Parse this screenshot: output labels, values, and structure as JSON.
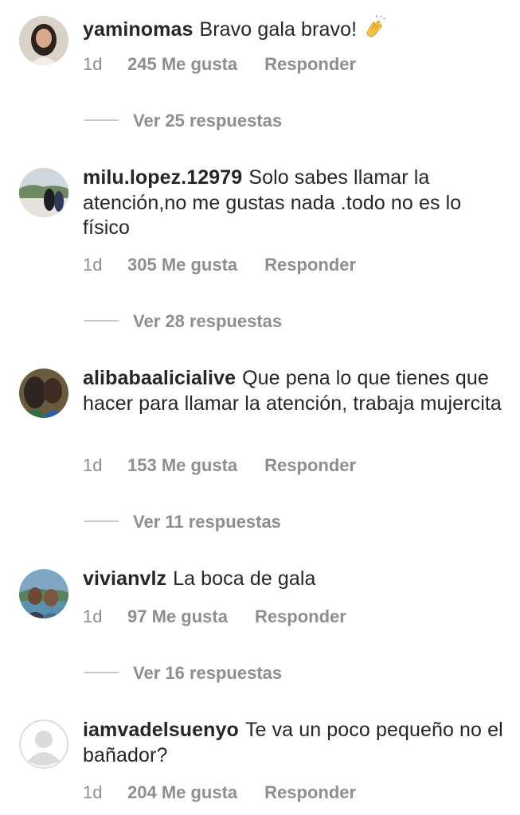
{
  "comments": [
    {
      "username": "yaminomas",
      "text": "Bravo gala bravo!",
      "emoji": "clapping-hands-icon",
      "time": "1d",
      "likes": "245 Me gusta",
      "reply_label": "Responder",
      "view_replies": "Ver 25 respuestas"
    },
    {
      "username": "milu.lopez.12979",
      "text": "Solo sabes llamar la atención,no me gustas nada .todo no es lo físico",
      "time": "1d",
      "likes": "305 Me gusta",
      "reply_label": "Responder",
      "view_replies": "Ver 28 respuestas"
    },
    {
      "username": "alibabaalicialive",
      "text": "Que pena lo que tienes que hacer para llamar la atención, trabaja mujercita",
      "time": "1d",
      "likes": "153 Me gusta",
      "reply_label": "Responder",
      "view_replies": "Ver 11 respuestas"
    },
    {
      "username": "vivianvlz",
      "text": "La boca de gala",
      "time": "1d",
      "likes": "97 Me gusta",
      "reply_label": "Responder",
      "view_replies": "Ver 16 respuestas"
    },
    {
      "username": "iamvadelsueny o",
      "text": "Te va un poco pequeño no el bañador?",
      "time": "1d",
      "likes": "204 Me gusta",
      "reply_label": "Responder"
    }
  ],
  "colors": {
    "text": "#262626",
    "secondary": "#8e8e8e",
    "divider": "#c7c7c7"
  }
}
